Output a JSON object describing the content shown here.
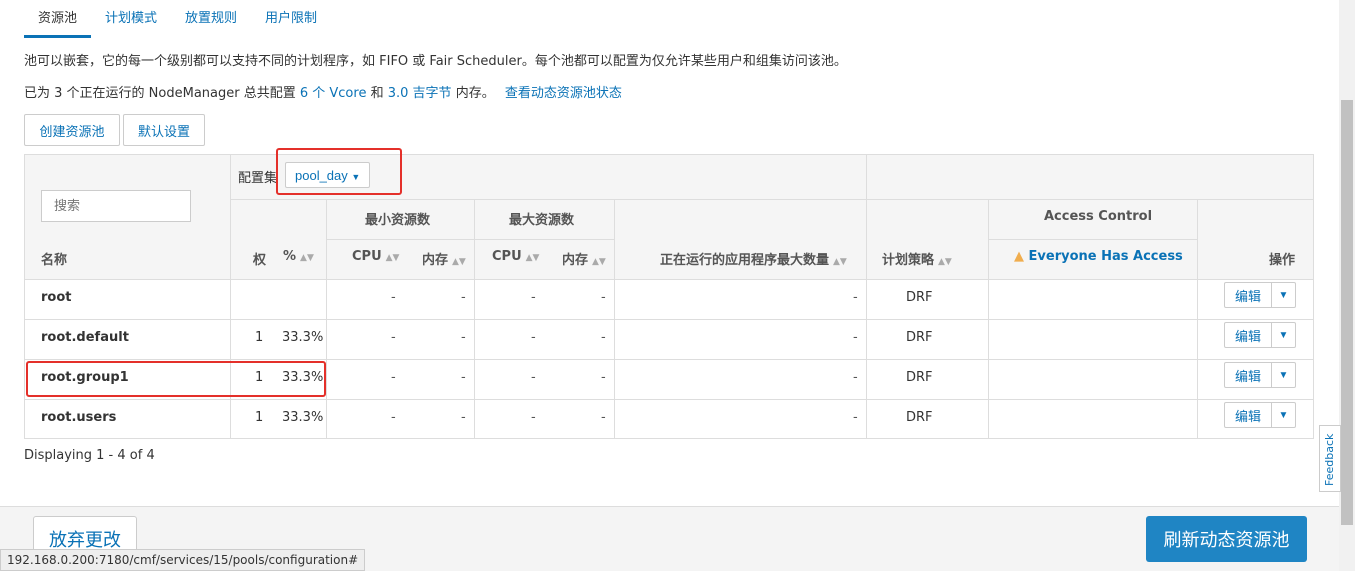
{
  "tabs": [
    "资源池",
    "计划模式",
    "放置规则",
    "用户限制"
  ],
  "description": {
    "line1": "池可以嵌套，它的每一个级别都可以支持不同的计划程序，如 FIFO 或 Fair Scheduler。每个池都可以配置为仅允许某些用户和组集访问该池。",
    "line2_prefix": "已为 3 个正在运行的 NodeManager 总共配置",
    "vcore_link": "6 个 Vcore",
    "and": "和",
    "mem_link": "3.0 吉字节",
    "line2_suffix": "内存。",
    "dynamic_link": "查看动态资源池状态"
  },
  "buttons": {
    "create": "创建资源池",
    "defaults": "默认设置",
    "edit": "编辑",
    "discard": "放弃更改",
    "refresh": "刷新动态资源池"
  },
  "search": {
    "placeholder": "搜索"
  },
  "config_set": {
    "label": "配置集",
    "value": "pool_day"
  },
  "headers": {
    "name": "名称",
    "weight": "权",
    "percent": "%",
    "min_resources": "最小资源数",
    "max_resources": "最大资源数",
    "cpu": "CPU",
    "memory": "内存",
    "max_running_apps": "正在运行的应用程序最大数量",
    "policy": "计划策略",
    "access_control": "Access Control",
    "everyone_access": "Everyone Has Access",
    "actions": "操作"
  },
  "rows": [
    {
      "name": "root",
      "weight": "",
      "percent": "",
      "min_cpu": "-",
      "min_mem": "-",
      "max_cpu": "-",
      "max_mem": "-",
      "max_apps": "-",
      "policy": "DRF"
    },
    {
      "name": "root.default",
      "weight": "1",
      "percent": "33.3%",
      "min_cpu": "-",
      "min_mem": "-",
      "max_cpu": "-",
      "max_mem": "-",
      "max_apps": "-",
      "policy": "DRF"
    },
    {
      "name": "root.group1",
      "weight": "1",
      "percent": "33.3%",
      "min_cpu": "-",
      "min_mem": "-",
      "max_cpu": "-",
      "max_mem": "-",
      "max_apps": "-",
      "policy": "DRF"
    },
    {
      "name": "root.users",
      "weight": "1",
      "percent": "33.3%",
      "min_cpu": "-",
      "min_mem": "-",
      "max_cpu": "-",
      "max_mem": "-",
      "max_apps": "-",
      "policy": "DRF"
    }
  ],
  "pagination": "Displaying 1 - 4 of 4",
  "status_url": "192.168.0.200:7180/cmf/services/15/pools/configuration#",
  "feedback": "Feedback",
  "colors": {
    "accent": "#0a72b6",
    "primary_button": "#1f85c4",
    "highlight": "#e4302a",
    "warning": "#f0ad4e"
  }
}
